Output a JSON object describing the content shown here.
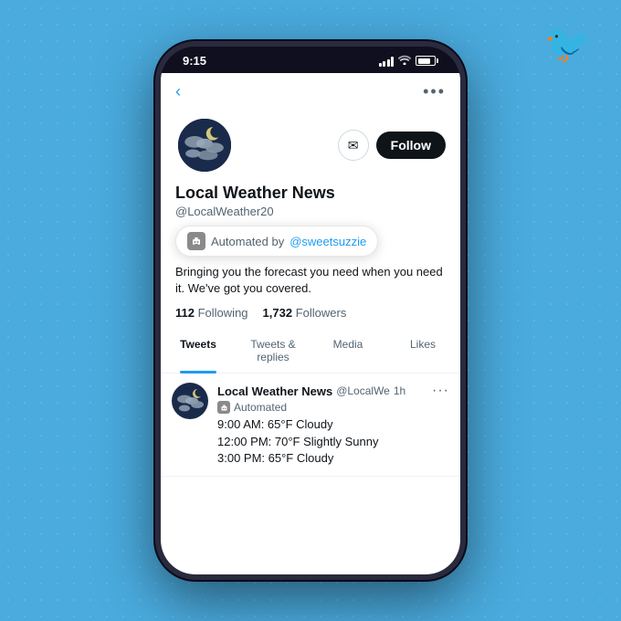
{
  "background": {
    "color": "#4AABDE"
  },
  "twitter_logo": "🐦",
  "phone": {
    "status_bar": {
      "time": "9:15",
      "signal_bars": [
        4,
        6,
        8,
        10,
        12
      ],
      "wifi": "wifi",
      "battery": 80
    },
    "nav": {
      "back": "‹",
      "more": "•••"
    },
    "profile": {
      "name": "Local Weather News",
      "handle": "@LocalWeather20",
      "automated_label": "Automated by",
      "automated_by": "@sweetsuzzie",
      "bio": "Bringing you the forecast you need when you need it.  We've got you covered.",
      "following_count": "112",
      "following_label": "Following",
      "followers_count": "1,732",
      "followers_label": "Followers",
      "mail_icon": "✉",
      "follow_label": "Follow"
    },
    "tabs": [
      {
        "label": "Tweets",
        "active": true
      },
      {
        "label": "Tweets & replies",
        "active": false
      },
      {
        "label": "Media",
        "active": false
      },
      {
        "label": "Likes",
        "active": false
      }
    ],
    "tweets": [
      {
        "name": "Local Weather News",
        "handle": "@LocalWe",
        "time": "1h",
        "automated": "Automated",
        "lines": [
          "9:00 AM: 65°F Cloudy",
          "12:00 PM: 70°F Slightly Sunny",
          "3:00 PM: 65°F Cloudy"
        ]
      }
    ]
  }
}
